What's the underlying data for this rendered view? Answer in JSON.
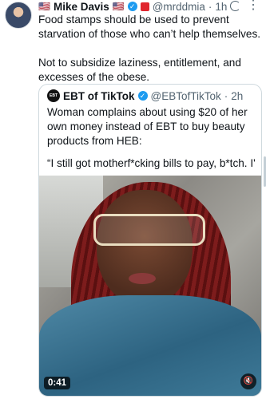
{
  "tweet": {
    "author_name": "Mike Davis",
    "author_flag_left": "🇺🇸",
    "author_flag_right": "🇺🇸",
    "handle": "@mrddmia",
    "separator": "·",
    "time": "1h",
    "text": "Food stamps should be used to prevent starvation of those who can’t help themselves.\n\nNot to subsidize laziness, entitlement, and excesses of the obese.",
    "more_icon": "more-horizontal-icon",
    "grok_icon": "grok-icon"
  },
  "quote": {
    "avatar_text": "EBT",
    "author_name": "EBT of TikTok",
    "handle": "@EBTofTikTok",
    "separator": "·",
    "time": "2h",
    "text": "Woman complains about using $20 of her own money instead of EBT to buy beauty products from HEB:",
    "snippet": "“I still got motherf*cking bills to pay, b*tch. I'...",
    "media": {
      "duration": "0:41",
      "mute_icon": "speaker-muted-icon"
    }
  },
  "colors": {
    "verified": "#1d9bf0",
    "text_primary": "#0f1419",
    "text_secondary": "#536471",
    "border": "#cfd9de"
  }
}
